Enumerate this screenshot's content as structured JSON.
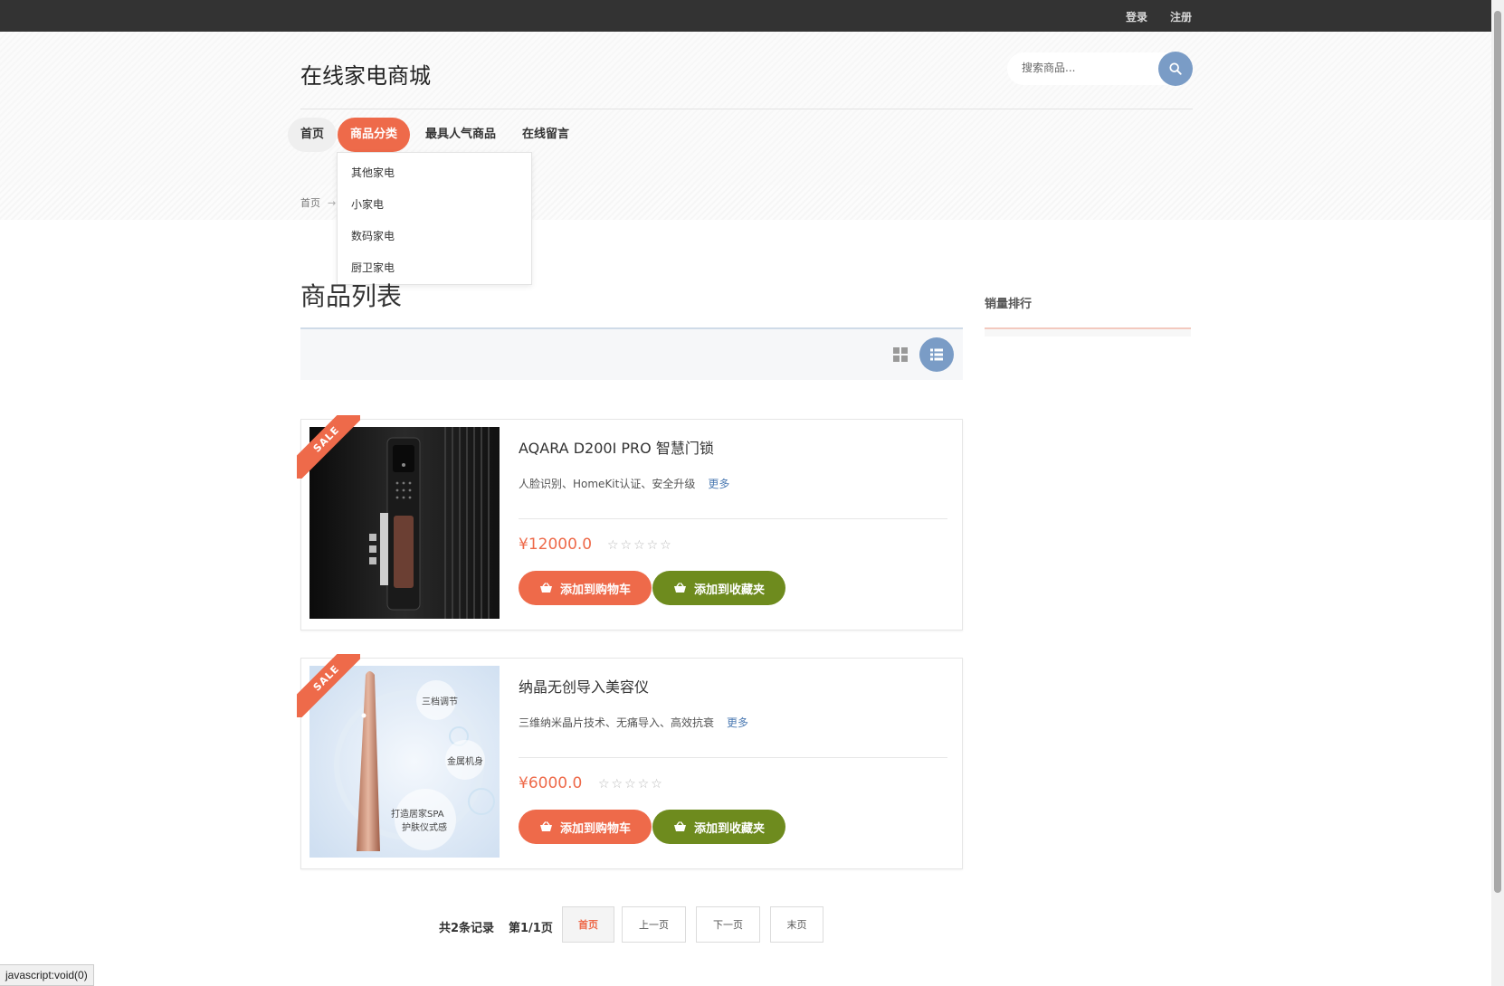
{
  "topbar": {
    "login": "登录",
    "register": "注册"
  },
  "header": {
    "logo": "在线家电商城",
    "search_placeholder": "搜索商品..."
  },
  "nav": {
    "items": [
      "首页",
      "商品分类",
      "最具人气商品",
      "在线留言"
    ],
    "dropdown": [
      "其他家电",
      "小家电",
      "数码家电",
      "厨卫家电"
    ]
  },
  "breadcrumb": {
    "home": "首页",
    "separator": "→"
  },
  "main": {
    "title": "商品列表"
  },
  "sidebar": {
    "title": "销量排行"
  },
  "ribbon": "SALE",
  "products": [
    {
      "name": "AQARA D200I PRO 智慧门锁",
      "desc": "人脸识别、HomeKit认证、安全升级",
      "more": "更多",
      "price": "¥12000.0",
      "stars": "☆☆☆☆☆",
      "cart_label": "添加到购物车",
      "fav_label": "添加到收藏夹"
    },
    {
      "name": "纳晶无创导入美容仪",
      "desc": "三维纳米晶片技术、无痛导入、高效抗衰",
      "more": "更多",
      "price": "¥6000.0",
      "stars": "☆☆☆☆☆",
      "cart_label": "添加到购物车",
      "fav_label": "添加到收藏夹",
      "image_labels": [
        "三档调节",
        "金属机身",
        "打造居家SPA",
        "护肤仪式感"
      ]
    }
  ],
  "pagination": {
    "total": "共2条记录",
    "page": "第1/1页",
    "first": "首页",
    "prev": "上一页",
    "next": "下一页",
    "last": "末页"
  },
  "status_bar": "javascript:void(0)",
  "colors": {
    "accent": "#ee6a4a",
    "blue": "#7a9cc6",
    "green": "#6e8b1e",
    "topbar": "#333333"
  },
  "icons": [
    "search-icon",
    "grid-view-icon",
    "list-view-icon",
    "basket-icon"
  ]
}
